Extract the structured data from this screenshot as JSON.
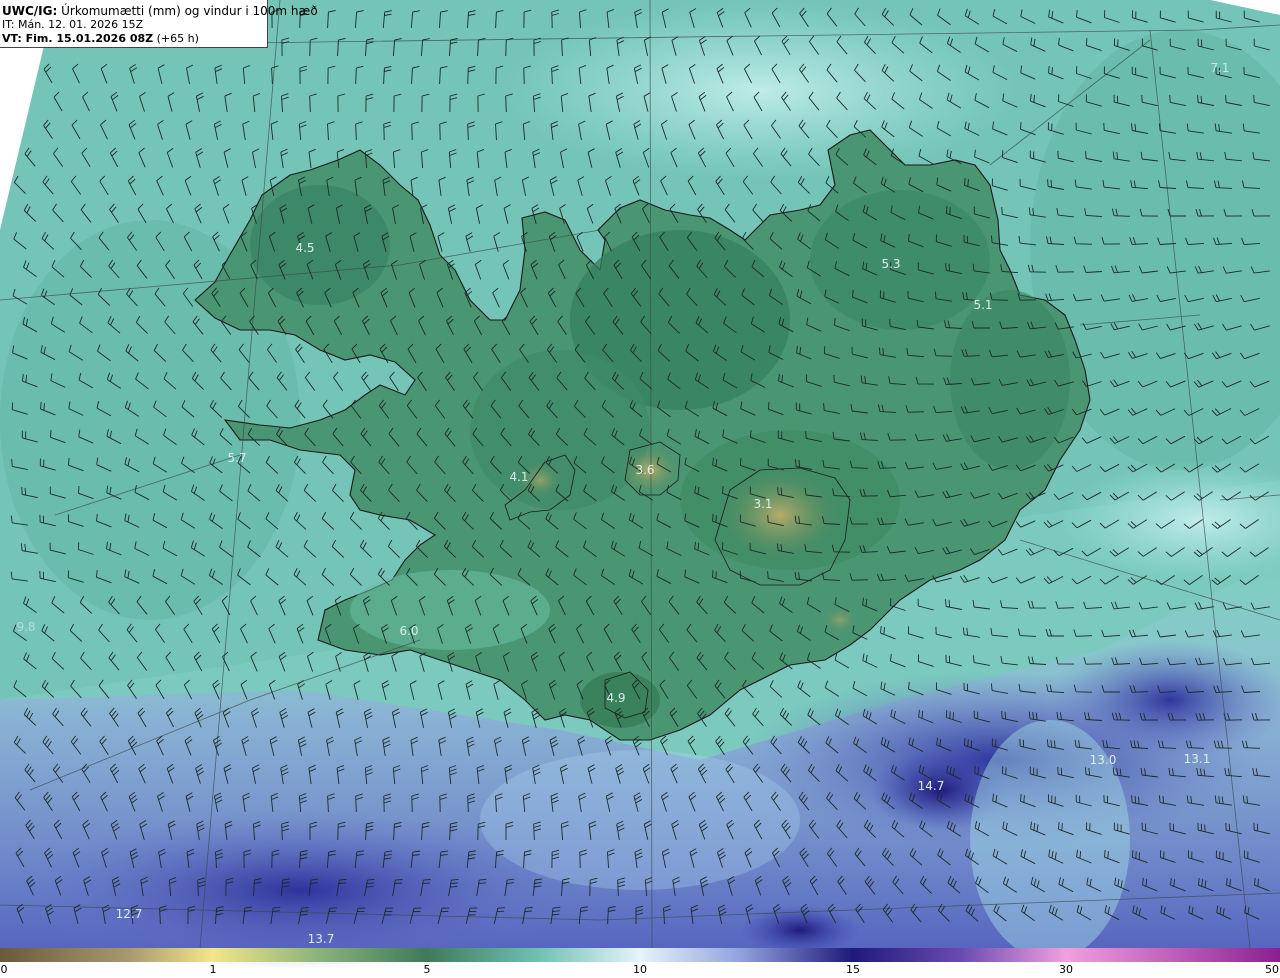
{
  "header": {
    "model": "UWC/IG:",
    "title": "Úrkomumætti (mm) og vindur i 100m hæð",
    "issue_time": "IT: Mán. 12. 01. 2026 15Z",
    "valid_prefix": "VT: Fim. 15.01.2026 08Z",
    "valid_suffix": "(+65 h)"
  },
  "map_labels": [
    {
      "text": "7.1"
    },
    {
      "text": "4.5"
    },
    {
      "text": "5.3"
    },
    {
      "text": "5.1"
    },
    {
      "text": "5.7"
    },
    {
      "text": "4.1"
    },
    {
      "text": "3.6"
    },
    {
      "text": "3.1"
    },
    {
      "text": "9.8"
    },
    {
      "text": "6.0"
    },
    {
      "text": "4.9"
    },
    {
      "text": "13.0"
    },
    {
      "text": "13.1"
    },
    {
      "text": "14.7"
    },
    {
      "text": "12.7"
    },
    {
      "text": "13.7"
    }
  ],
  "colorbar": {
    "ticks": [
      "0",
      "1",
      "5",
      "10",
      "15",
      "30",
      "50"
    ],
    "colors": [
      "#6b5a3a",
      "#c9b98a",
      "#f3e58a",
      "#3f7a5a",
      "#a8e6e0",
      "#e6f4fa",
      "#1e1a7a",
      "#b87fcf",
      "#f0a0e0",
      "#8a2090"
    ]
  },
  "colors": {
    "sea_light": "#8fd6cf",
    "land_green": "#3f8a66",
    "heavy_precip": "#3c46b4",
    "highland": "#a6a460"
  }
}
